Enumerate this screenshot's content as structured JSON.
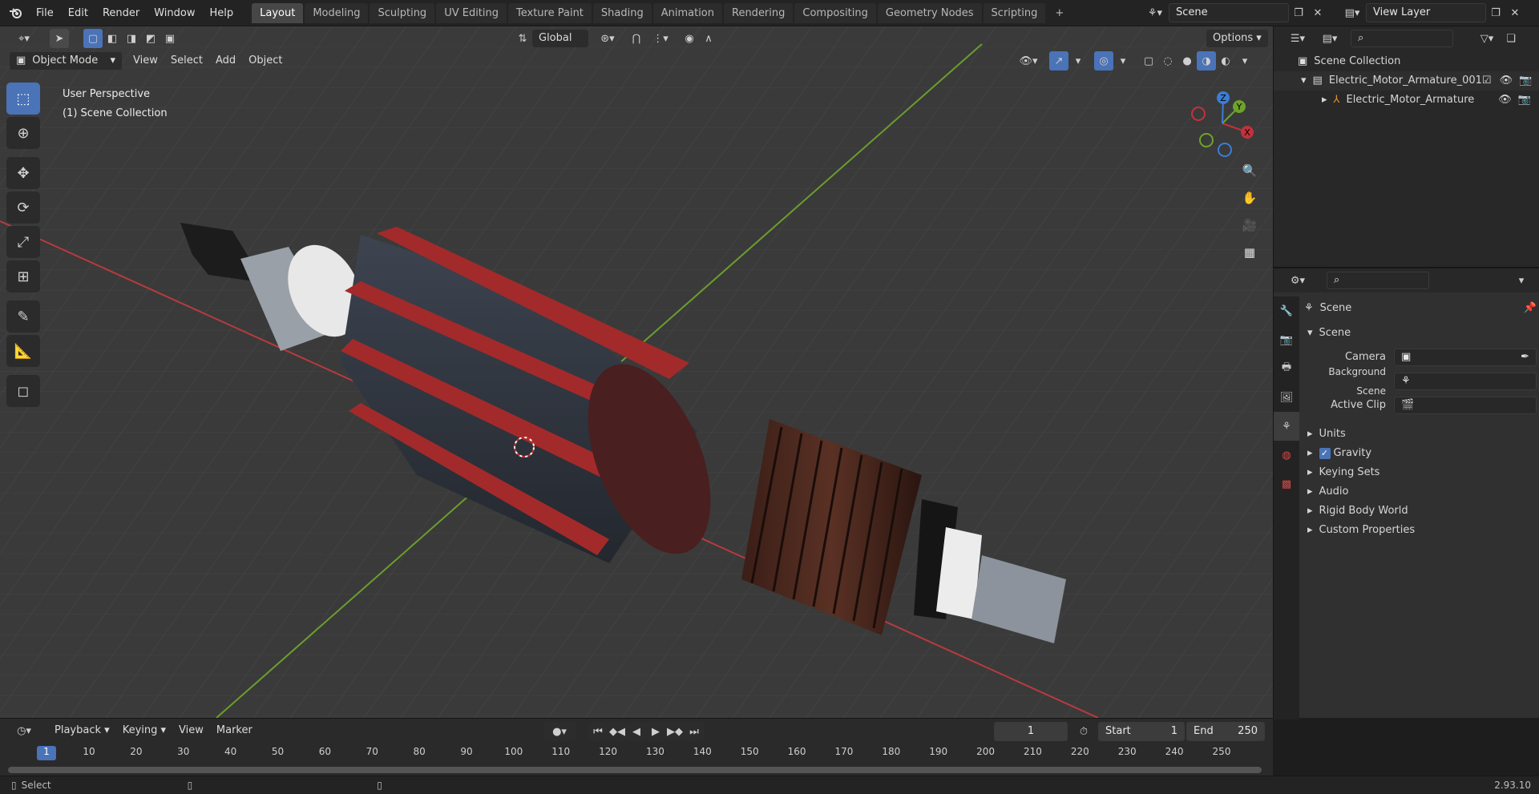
{
  "menu": {
    "logo": "blender-logo",
    "items": [
      "File",
      "Edit",
      "Render",
      "Window",
      "Help"
    ]
  },
  "workspaces": [
    "Layout",
    "Modeling",
    "Sculpting",
    "UV Editing",
    "Texture Paint",
    "Shading",
    "Animation",
    "Rendering",
    "Compositing",
    "Geometry Nodes",
    "Scripting"
  ],
  "active_workspace": "Layout",
  "scene_field": "Scene",
  "view_layer_field": "View Layer",
  "viewport": {
    "transform_orientation": "Global",
    "options_label": "Options",
    "mode": "Object Mode",
    "header_menus": [
      "View",
      "Select",
      "Add",
      "Object"
    ],
    "overlay_line1": "User Perspective",
    "overlay_line2": "(1) Scene Collection",
    "gizmo_axes": [
      "X",
      "Y",
      "Z"
    ]
  },
  "outliner": {
    "root": "Scene Collection",
    "items": [
      {
        "name": "Electric_Motor_Armature_001",
        "indent": 1
      },
      {
        "name": "Electric_Motor_Armature",
        "indent": 2
      }
    ]
  },
  "properties": {
    "context": "Scene",
    "section": "Scene",
    "fields": [
      {
        "label": "Camera",
        "value": ""
      },
      {
        "label": "Background Scene",
        "value": ""
      },
      {
        "label": "Active Clip",
        "value": ""
      }
    ],
    "panels": [
      "Units",
      "Gravity",
      "Keying Sets",
      "Audio",
      "Rigid Body World",
      "Custom Properties"
    ],
    "gravity_checked": true
  },
  "timeline": {
    "menus": [
      "Playback",
      "Keying",
      "View",
      "Marker"
    ],
    "current_frame": "1",
    "start_label": "Start",
    "start_value": "1",
    "end_label": "End",
    "end_value": "250",
    "ticks": [
      "1",
      "10",
      "20",
      "30",
      "40",
      "50",
      "60",
      "70",
      "80",
      "90",
      "100",
      "110",
      "120",
      "130",
      "140",
      "150",
      "160",
      "170",
      "180",
      "190",
      "200",
      "210",
      "220",
      "230",
      "240",
      "250"
    ]
  },
  "status": {
    "left": "Select",
    "version": "2.93.10"
  },
  "colors": {
    "accent": "#4a73b8",
    "x_axis": "#c2323c",
    "y_axis": "#6ea22c",
    "z_axis": "#3c7cd6",
    "armature_red": "#b52828"
  }
}
